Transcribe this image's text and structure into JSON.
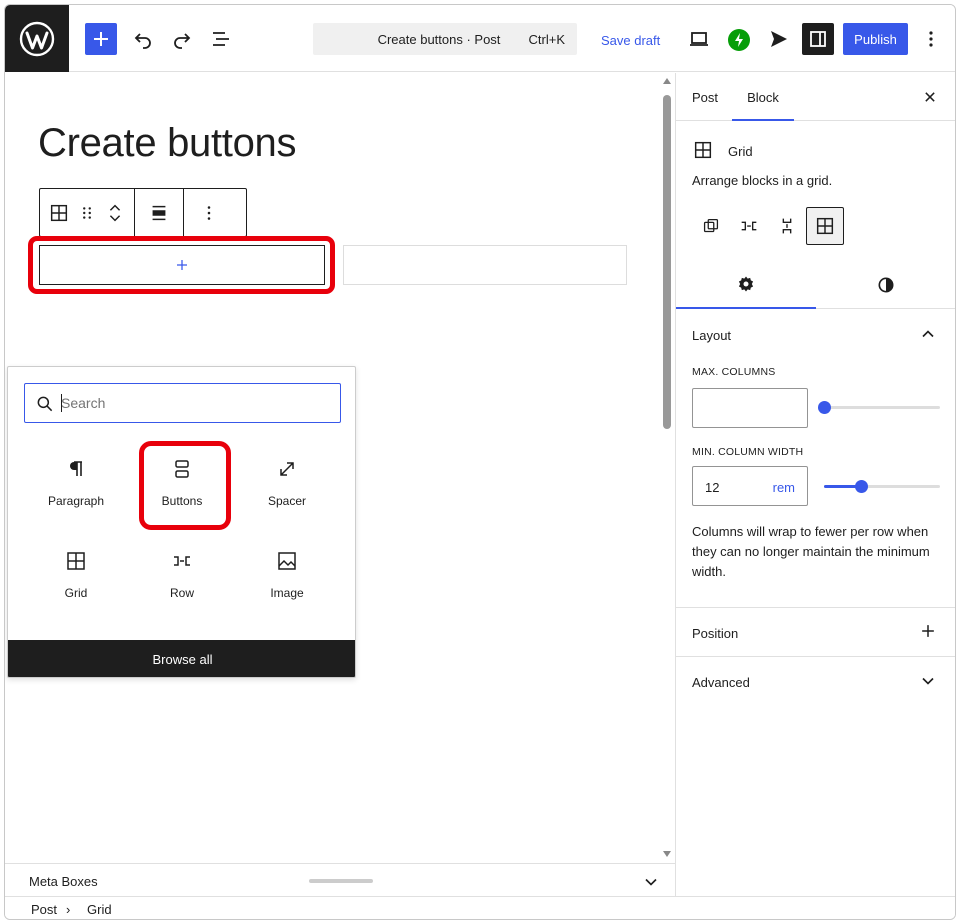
{
  "header": {
    "command_bar_title": "Create buttons · Post",
    "command_bar_shortcut": "Ctrl+K",
    "save_draft_label": "Save draft",
    "publish_label": "Publish"
  },
  "editor": {
    "post_title": "Create buttons"
  },
  "inserter": {
    "search_placeholder": "Search",
    "blocks": [
      {
        "label": "Paragraph",
        "icon": "paragraph-icon"
      },
      {
        "label": "Buttons",
        "icon": "buttons-icon"
      },
      {
        "label": "Spacer",
        "icon": "spacer-icon"
      },
      {
        "label": "Grid",
        "icon": "grid-icon"
      },
      {
        "label": "Row",
        "icon": "row-icon"
      },
      {
        "label": "Image",
        "icon": "image-icon"
      }
    ],
    "browse_all_label": "Browse all"
  },
  "meta_boxes": {
    "label": "Meta Boxes"
  },
  "breadcrumb": {
    "items": [
      "Post",
      "Grid"
    ],
    "separator": "›"
  },
  "sidebar": {
    "tabs": [
      "Post",
      "Block"
    ],
    "active_tab": "Block",
    "block_card": {
      "name": "Grid",
      "description": "Arrange blocks in a grid."
    },
    "layout_panel": {
      "title": "Layout",
      "max_columns_label": "MAX. COLUMNS",
      "max_columns_value": "",
      "max_columns_slider_level": 0,
      "min_column_width_label": "MIN. COLUMN WIDTH",
      "min_column_width_value": "12",
      "min_column_width_unit": "rem",
      "min_column_width_slider_level": 0.3,
      "help_text": "Columns will wrap to fewer per row when they can no longer maintain the minimum width."
    },
    "position_panel": {
      "title": "Position"
    },
    "advanced_panel": {
      "title": "Advanced"
    }
  },
  "colors": {
    "accent": "#3858e9",
    "highlight_red": "#e8000b",
    "jetpack_green": "#069e08",
    "dark": "#1e1e1e"
  }
}
